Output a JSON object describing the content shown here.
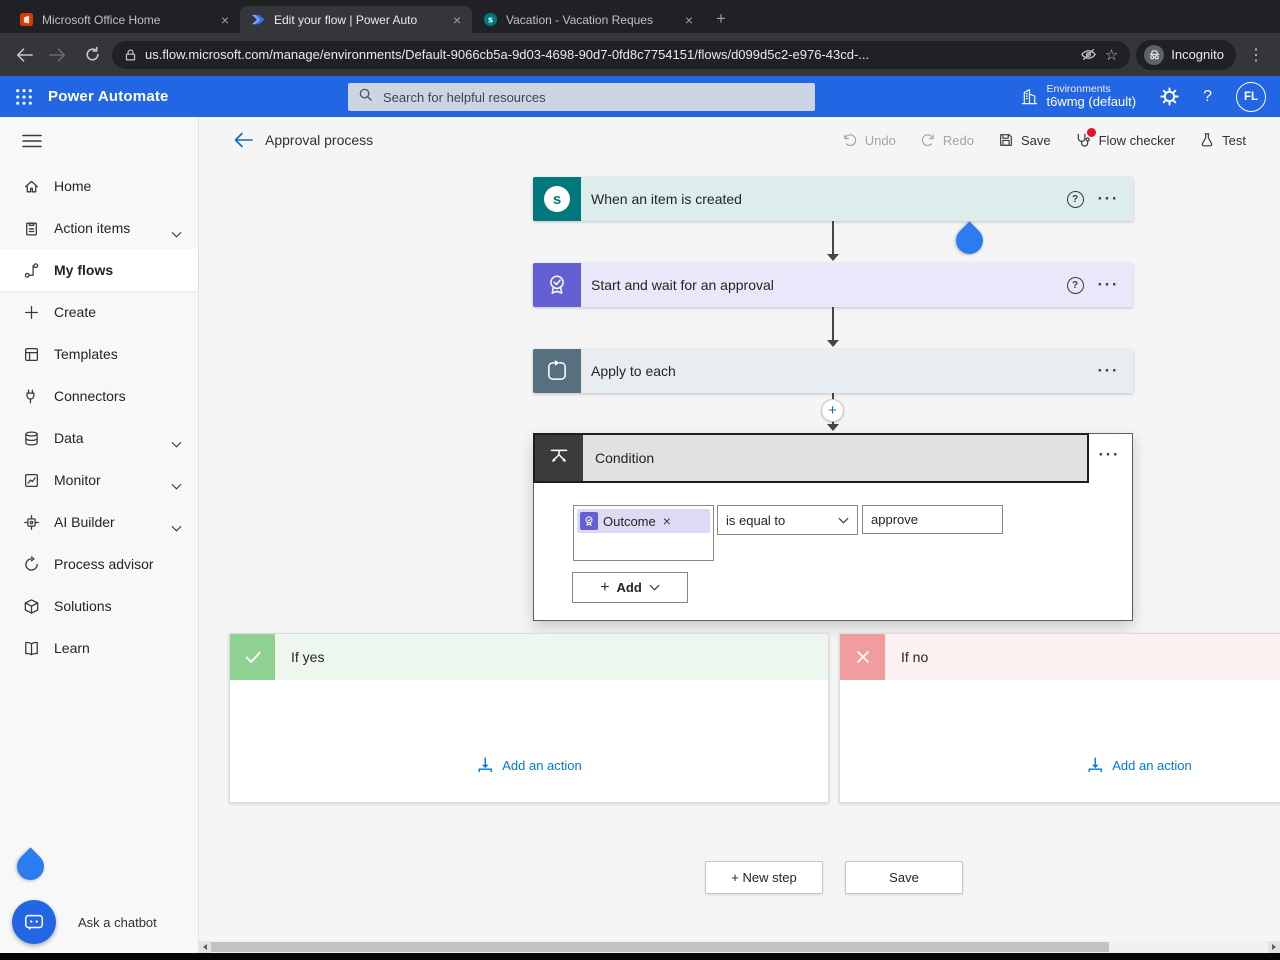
{
  "browser": {
    "tabs": [
      {
        "title": "Microsoft Office Home"
      },
      {
        "title": "Edit your flow | Power Auto"
      },
      {
        "title": "Vacation - Vacation Reques"
      }
    ],
    "url": "us.flow.microsoft.com/manage/environments/Default-9066cb5a-9d03-4698-90d7-0fd8c7754151/flows/d099d5c2-e976-43cd-...",
    "incognito_label": "Incognito"
  },
  "icons": {
    "help": "?",
    "more": "···",
    "more_vertical": "⋮",
    "close": "×",
    "star": "☆",
    "plus": "+",
    "sharepoint_letter": "s"
  },
  "header": {
    "app_name": "Power Automate",
    "search_placeholder": "Search for helpful resources",
    "environments_label": "Environments",
    "environment_name": "t6wmg (default)",
    "avatar_initials": "FL"
  },
  "sidebar": {
    "items": [
      {
        "label": "Home"
      },
      {
        "label": "Action items"
      },
      {
        "label": "My flows"
      },
      {
        "label": "Create"
      },
      {
        "label": "Templates"
      },
      {
        "label": "Connectors"
      },
      {
        "label": "Data"
      },
      {
        "label": "Monitor"
      },
      {
        "label": "AI Builder"
      },
      {
        "label": "Process advisor"
      },
      {
        "label": "Solutions"
      },
      {
        "label": "Learn"
      }
    ],
    "chatbot_label": "Ask a chatbot"
  },
  "toolbar": {
    "title": "Approval process",
    "undo": "Undo",
    "redo": "Redo",
    "save": "Save",
    "flow_checker": "Flow checker",
    "test": "Test"
  },
  "flow": {
    "trigger_title": "When an item is created",
    "approval_title": "Start and wait for an approval",
    "apply_title": "Apply to each",
    "condition_title": "Condition",
    "operand": "Outcome",
    "operator": "is equal to",
    "value": "approve",
    "add_label": "Add",
    "if_yes": "If yes",
    "if_no": "If no",
    "add_action": "Add an action",
    "new_step": "+ New step",
    "save": "Save"
  },
  "colors": {
    "pa_header": "#2266e3",
    "sharepoint_teal": "#03787c",
    "trigger_bg": "#ddedec",
    "approvals_purple": "#655fd4",
    "approval_bg": "#e9e8fa",
    "apply_icon": "#56707f",
    "apply_bg": "#e8edf1",
    "condition_icon": "#3d3b39",
    "if_yes_icon": "#8fd190",
    "if_yes_bg": "#edf7ed",
    "if_no_icon": "#f29d9d",
    "if_no_bg": "#fdf0f1",
    "link_blue": "#0078d4",
    "cursor_blue": "#2a7cf0"
  }
}
